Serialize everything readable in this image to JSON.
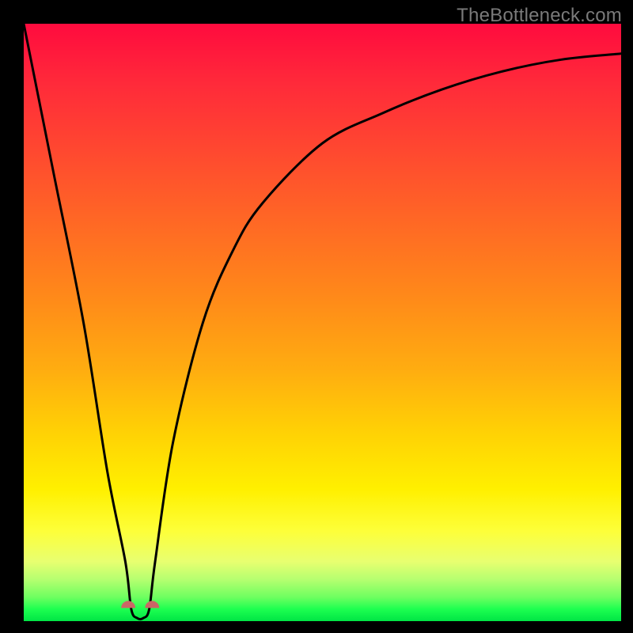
{
  "watermark": "TheBottleneck.com",
  "chart_data": {
    "type": "line",
    "title": "",
    "xlabel": "",
    "ylabel": "",
    "xlim": [
      0,
      100
    ],
    "ylim": [
      0,
      100
    ],
    "note": "schematic curve; axes unlabeled in source image",
    "series": [
      {
        "name": "bottleneck-curve",
        "x": [
          0,
          5,
          10,
          14,
          17,
          18,
          19,
          20,
          21,
          22,
          25,
          30,
          35,
          40,
          50,
          60,
          70,
          80,
          90,
          100
        ],
        "values": [
          100,
          75,
          50,
          25,
          10,
          2,
          0.5,
          0.5,
          2,
          10,
          30,
          50,
          62,
          70,
          80,
          85,
          89,
          92,
          94,
          95
        ]
      }
    ],
    "markers": [
      {
        "x": 17.5,
        "y": 2.2
      },
      {
        "x": 21.5,
        "y": 2.2
      }
    ]
  },
  "colors": {
    "curve": "#000000",
    "marker": "#cc6666",
    "frame": "#000000"
  }
}
